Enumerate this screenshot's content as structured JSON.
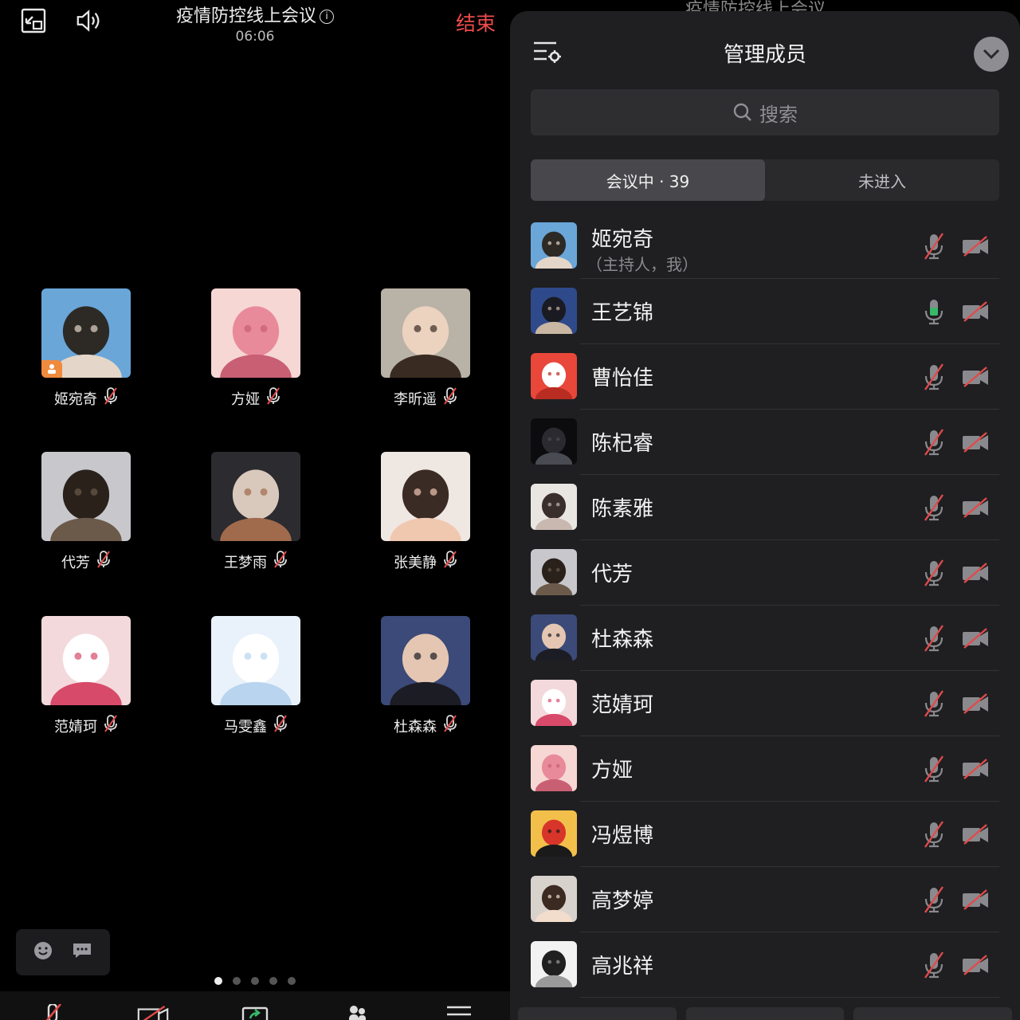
{
  "meeting": {
    "title": "疫情防控线上会议",
    "info_icon": "info-icon",
    "time": "06:06",
    "end_label": "结束",
    "participants": [
      {
        "name": "姬宛奇",
        "muted": true,
        "host": true,
        "avatar": [
          "#6aa6d8",
          "#2d2a26",
          "#e4d6c8"
        ]
      },
      {
        "name": "方娅",
        "muted": true,
        "avatar": [
          "#f6d7d3",
          "#e88a9a",
          "#c85f72"
        ]
      },
      {
        "name": "李昕遥",
        "muted": true,
        "avatar": [
          "#b9b2a6",
          "#ecd3bf",
          "#3a2b22"
        ]
      },
      {
        "name": "代芳",
        "muted": true,
        "avatar": [
          "#c8c8cc",
          "#2a211b",
          "#6b5a4a"
        ]
      },
      {
        "name": "王梦雨",
        "muted": true,
        "avatar": [
          "#2b2b30",
          "#d9c8bc",
          "#a06a4c"
        ]
      },
      {
        "name": "张美静",
        "muted": true,
        "avatar": [
          "#efe7e2",
          "#3b2b25",
          "#f0c8b0"
        ]
      },
      {
        "name": "范婧珂",
        "muted": true,
        "avatar": [
          "#f3d9dc",
          "#ffffff",
          "#d84a6a"
        ]
      },
      {
        "name": "马雯鑫",
        "muted": true,
        "avatar": [
          "#e9f2fb",
          "#ffffff",
          "#b8d4ee"
        ]
      },
      {
        "name": "杜森森",
        "muted": true,
        "avatar": [
          "#3b4a78",
          "#e5c6b2",
          "#1c1c24"
        ]
      }
    ],
    "page_dots": 5,
    "active_dot": 0
  },
  "members_panel": {
    "peek_title": "疫情防控线上会议",
    "title": "管理成员",
    "search_placeholder": "搜索",
    "tabs": [
      {
        "label": "会议中 · 39",
        "active": true
      },
      {
        "label": "未进入",
        "active": false
      }
    ],
    "members": [
      {
        "name": "姬宛奇",
        "sub": "（主持人，我）",
        "mic_on": false,
        "cam_on": false,
        "avatar": [
          "#6aa6d8",
          "#2d2a26",
          "#e4d6c8"
        ]
      },
      {
        "name": "王艺锦",
        "sub": "",
        "mic_on": true,
        "cam_on": false,
        "avatar": [
          "#2f4a8a",
          "#1a1a22",
          "#c9b7a3"
        ]
      },
      {
        "name": "曹怡佳",
        "sub": "",
        "mic_on": false,
        "cam_on": false,
        "avatar": [
          "#e8473a",
          "#ffffff",
          "#b82c22"
        ]
      },
      {
        "name": "陈杞睿",
        "sub": "",
        "mic_on": false,
        "cam_on": false,
        "avatar": [
          "#0c0c0e",
          "#2a2a30",
          "#4a4a52"
        ]
      },
      {
        "name": "陈素雅",
        "sub": "",
        "mic_on": false,
        "cam_on": false,
        "avatar": [
          "#e9e6e2",
          "#3a2e2c",
          "#c9b8b0"
        ]
      },
      {
        "name": "代芳",
        "sub": "",
        "mic_on": false,
        "cam_on": false,
        "avatar": [
          "#c8c8cc",
          "#2a211b",
          "#6b5a4a"
        ]
      },
      {
        "name": "杜森森",
        "sub": "",
        "mic_on": false,
        "cam_on": false,
        "avatar": [
          "#3b4a78",
          "#e5c6b2",
          "#1c1c24"
        ]
      },
      {
        "name": "范婧珂",
        "sub": "",
        "mic_on": false,
        "cam_on": false,
        "avatar": [
          "#f3d9dc",
          "#ffffff",
          "#d84a6a"
        ]
      },
      {
        "name": "方娅",
        "sub": "",
        "mic_on": false,
        "cam_on": false,
        "avatar": [
          "#f6d7d3",
          "#e88a9a",
          "#c85f72"
        ]
      },
      {
        "name": "冯煜博",
        "sub": "",
        "mic_on": false,
        "cam_on": false,
        "avatar": [
          "#f2c04a",
          "#d8352a",
          "#1a1a1a"
        ]
      },
      {
        "name": "高梦婷",
        "sub": "",
        "mic_on": false,
        "cam_on": false,
        "avatar": [
          "#d8d2cc",
          "#3a2a22",
          "#f2dccc"
        ]
      },
      {
        "name": "高兆祥",
        "sub": "",
        "mic_on": false,
        "cam_on": false,
        "avatar": [
          "#f2f2f2",
          "#202020",
          "#9a9a9a"
        ]
      }
    ]
  },
  "colors": {
    "end_red": "#ef4b4b",
    "muted_red": "#e24a4a",
    "mic_green": "#39b86a",
    "sheet_bg": "#1f1f21"
  }
}
